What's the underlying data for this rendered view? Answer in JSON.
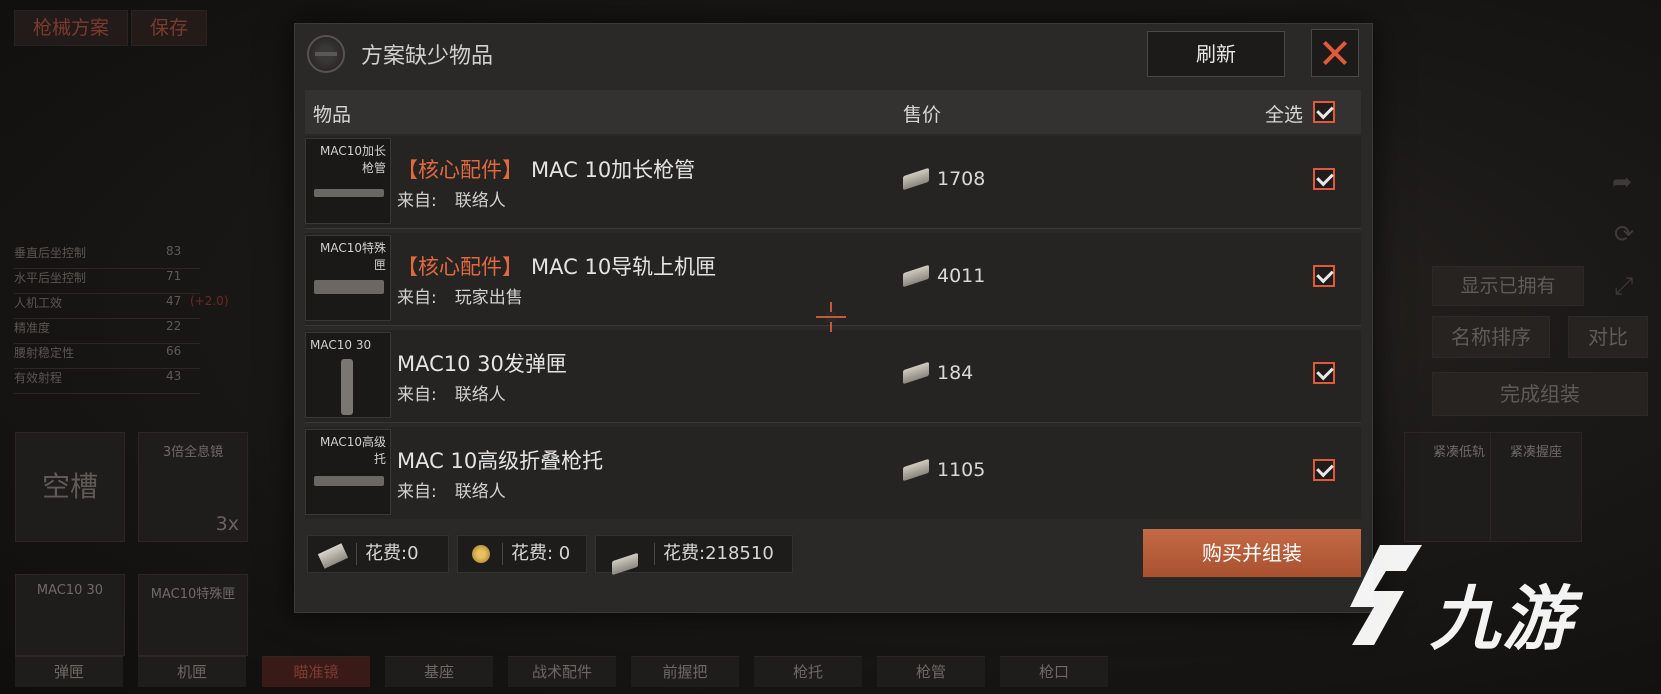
{
  "background": {
    "top_tabs": [
      "枪械方案",
      "保存"
    ],
    "stats": [
      {
        "label": "垂直后坐控制",
        "value": "83",
        "delta": ""
      },
      {
        "label": "水平后坐控制",
        "value": "71",
        "delta": ""
      },
      {
        "label": "人机工效",
        "value": "47",
        "delta": "(+2.0)"
      },
      {
        "label": "精准度",
        "value": "22",
        "delta": ""
      },
      {
        "label": "腰射稳定性",
        "value": "66",
        "delta": ""
      },
      {
        "label": "有效射程",
        "value": "43",
        "delta": ""
      }
    ],
    "slots_row1": [
      {
        "caption": "空槽",
        "mult": ""
      },
      {
        "caption": "3倍全息镜",
        "mult": "3x"
      }
    ],
    "slots_row2": [
      {
        "caption": "MAC10 30"
      },
      {
        "caption": "MAC10特殊匣"
      }
    ],
    "bottom_labels": [
      "弹匣",
      "机匣",
      "瞄准镜",
      "基座",
      "战术配件",
      "前握把",
      "枪托",
      "枪管",
      "枪口"
    ],
    "right_slot_captions": [
      "紧凑低轨",
      "紧凑握座"
    ],
    "show_owned_label": "显示已拥有",
    "sort_by_name_label": "名称排序",
    "compare_label": "对比",
    "complete_assembly_label": "完成组装"
  },
  "dialog": {
    "title": "方案缺少物品",
    "refresh_label": "刷新",
    "columns": {
      "item": "物品",
      "price": "售价",
      "select_all": "全选"
    },
    "select_all_checked": true,
    "source_prefix": "来自:",
    "items": [
      {
        "thumb_caption": "MAC10加长枪管",
        "tag": "【核心配件】",
        "name": "MAC 10加长枪管",
        "source": "联络人",
        "price": "1708",
        "checked": true
      },
      {
        "thumb_caption": "MAC10特殊匣",
        "tag": "【核心配件】",
        "name": "MAC 10导轨上机匣",
        "source": "玩家出售",
        "price": "4011",
        "checked": true
      },
      {
        "thumb_caption": "MAC10 30",
        "tag": "",
        "name": "MAC10 30发弹匣",
        "source": "联络人",
        "price": "184",
        "checked": true
      },
      {
        "thumb_caption": "MAC10高级托",
        "tag": "",
        "name": "MAC 10高级折叠枪托",
        "source": "联络人",
        "price": "1105",
        "checked": true
      }
    ],
    "costs": [
      {
        "icon": "ticket-icon",
        "label": "花费:0"
      },
      {
        "icon": "coin-icon",
        "label": "花费: 0"
      },
      {
        "icon": "cash-icon",
        "label": "花费:218510"
      }
    ],
    "buy_label": "购买并组装"
  },
  "watermark": {
    "text": "九游"
  },
  "colors": {
    "accent": "#e05a38",
    "buy_button": "#b85a38",
    "dialog_bg": "#2a2928",
    "tag": "#e0693f"
  }
}
